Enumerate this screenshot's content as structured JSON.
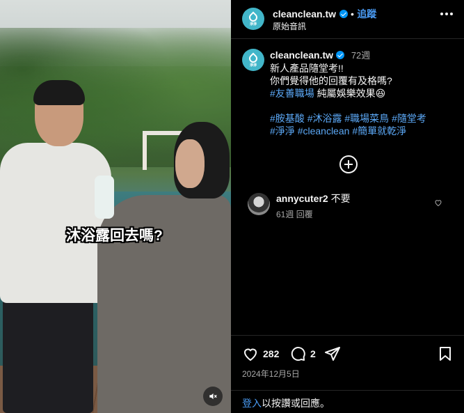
{
  "video": {
    "subtitle": "沐浴露回去嗎?",
    "mute_icon": "speaker-muted-icon"
  },
  "header": {
    "username": "cleanclean.tw",
    "separator": "•",
    "follow_label": "追蹤",
    "audio_label": "原始音訊",
    "avatar_text": "淨淨",
    "brand_color": "#42b6c9"
  },
  "caption": {
    "username": "cleanclean.tw",
    "time": "72週",
    "line1": "新人產品隨堂考!!",
    "line2": "你們覺得他的回覆有及格嗎?",
    "line3_tag": "#友善職場",
    "line3_text": "純屬娛樂效果😆",
    "tags_row1": [
      "#胺基酸",
      "#沐浴露",
      "#職場菜鳥",
      "#隨堂考"
    ],
    "tags_row2": [
      "#淨淨",
      "#cleanclean",
      "#簡單就乾淨"
    ]
  },
  "comments": [
    {
      "username": "annycuter2",
      "text": "不要",
      "time": "61週",
      "reply_label": "回覆"
    }
  ],
  "actions": {
    "likes": "282",
    "comments": "2",
    "date": "2024年12月5日"
  },
  "footer": {
    "login_link": "登入",
    "login_text": "以按讚或回應。"
  }
}
